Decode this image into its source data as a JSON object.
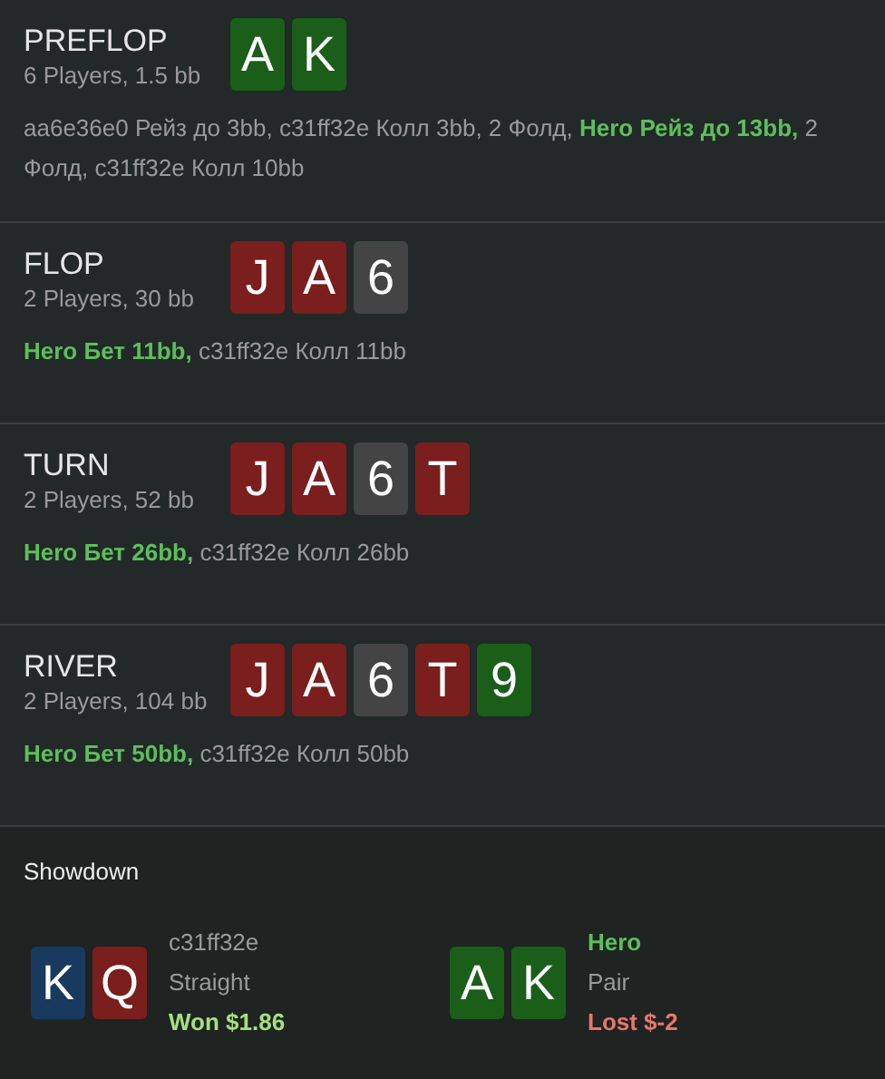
{
  "streets": [
    {
      "name": "PREFLOP",
      "info": "6 Players, 1.5 bb",
      "cards": [
        {
          "rank": "A",
          "color": "#1a5e1a"
        },
        {
          "rank": "K",
          "color": "#1a5e1a"
        }
      ],
      "actions": "aa6e36e0 Рейз до 3bb, c31ff32e Колл 3bb, 2 Фолд, **Hero Рейз до 13bb,** 2 Фолд, c31ff32e Колл 10bb"
    },
    {
      "name": "FLOP",
      "info": "2 Players, 30 bb",
      "cards": [
        {
          "rank": "J",
          "color": "#7a1e1e"
        },
        {
          "rank": "A",
          "color": "#7a1e1e"
        },
        {
          "rank": "6",
          "color": "#444444"
        }
      ],
      "actions": "**Hero Бет 11bb,** c31ff32e Колл 11bb"
    },
    {
      "name": "TURN",
      "info": "2 Players, 52 bb",
      "cards": [
        {
          "rank": "J",
          "color": "#7a1e1e"
        },
        {
          "rank": "A",
          "color": "#7a1e1e"
        },
        {
          "rank": "6",
          "color": "#444444"
        },
        {
          "rank": "T",
          "color": "#7a1e1e"
        }
      ],
      "actions": "**Hero Бет 26bb,** c31ff32e Колл 26bb"
    },
    {
      "name": "RIVER",
      "info": "2 Players, 104 bb",
      "cards": [
        {
          "rank": "J",
          "color": "#7a1e1e"
        },
        {
          "rank": "A",
          "color": "#7a1e1e"
        },
        {
          "rank": "6",
          "color": "#444444"
        },
        {
          "rank": "T",
          "color": "#7a1e1e"
        },
        {
          "rank": "9",
          "color": "#1a5e1a"
        }
      ],
      "actions": "**Hero Бет 50bb,** c31ff32e Колл 50bb"
    }
  ],
  "showdown": {
    "title": "Showdown",
    "players": [
      {
        "name": "c31ff32e",
        "hero": false,
        "hand": "Straight",
        "result": "Won $1.86",
        "kind": "won",
        "cards": [
          {
            "rank": "K",
            "color": "#173a5e"
          },
          {
            "rank": "Q",
            "color": "#7a1e1e"
          }
        ]
      },
      {
        "name": "Hero",
        "hero": true,
        "hand": "Pair",
        "result": "Lost $-2",
        "kind": "lost",
        "cards": [
          {
            "rank": "A",
            "color": "#1a5e1a"
          },
          {
            "rank": "K",
            "color": "#1a5e1a"
          }
        ]
      }
    ]
  }
}
